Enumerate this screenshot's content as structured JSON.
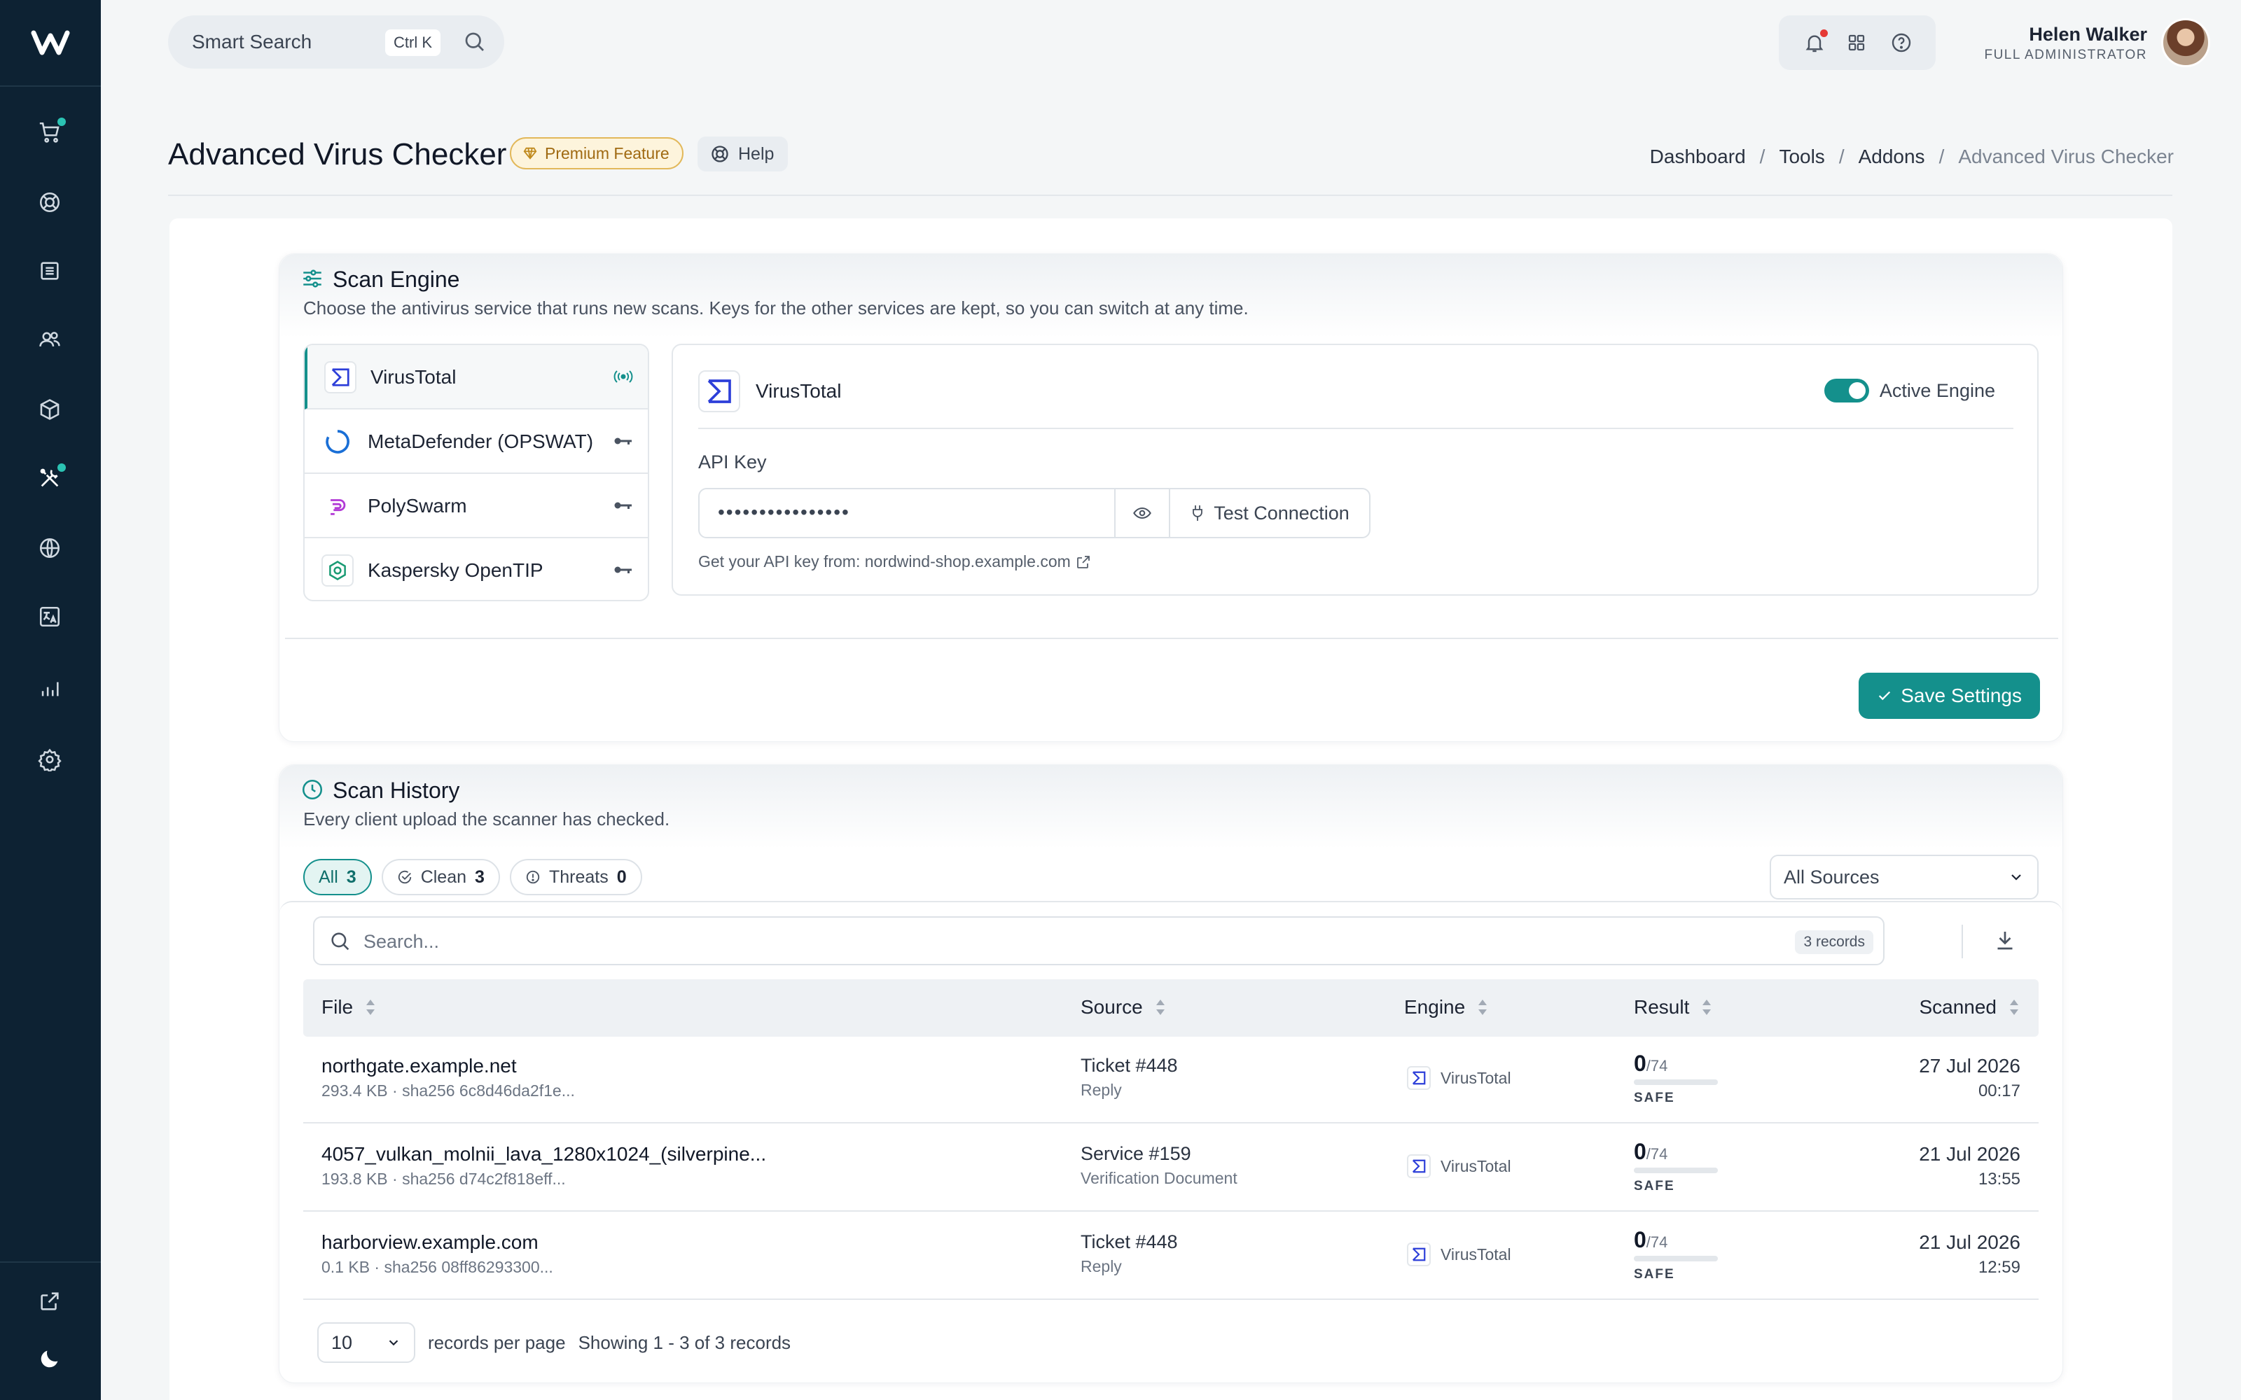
{
  "topbar": {
    "search_label": "Smart Search",
    "search_shortcut": "Ctrl K",
    "user_name": "Helen Walker",
    "user_role": "FULL ADMINISTRATOR"
  },
  "sidebar": {
    "items": [
      {
        "icon": "cart-icon",
        "badge": true
      },
      {
        "icon": "lifebuoy-icon",
        "badge": false
      },
      {
        "icon": "document-icon",
        "badge": false
      },
      {
        "icon": "users-icon",
        "badge": false
      },
      {
        "icon": "box-icon",
        "badge": false
      },
      {
        "icon": "tools-icon",
        "badge": true
      },
      {
        "icon": "globe-icon",
        "badge": false
      },
      {
        "icon": "translate-icon",
        "badge": false
      },
      {
        "icon": "chart-icon",
        "badge": false
      },
      {
        "icon": "settings-icon",
        "badge": false
      }
    ],
    "bottom": [
      "external-link-icon",
      "moon-icon"
    ]
  },
  "header": {
    "title": "Advanced Virus Checker",
    "premium_badge": "Premium Feature",
    "help_label": "Help",
    "breadcrumb": [
      "Dashboard",
      "Tools",
      "Addons",
      "Advanced Virus Checker"
    ]
  },
  "scan_engine": {
    "title": "Scan Engine",
    "subtitle": "Choose the antivirus service that runs new scans. Keys for the other services are kept, so you can switch at any time.",
    "engines": [
      {
        "name": "VirusTotal",
        "active": true
      },
      {
        "name": "MetaDefender (OPSWAT)",
        "active": false
      },
      {
        "name": "PolySwarm",
        "active": false
      },
      {
        "name": "Kaspersky OpenTIP",
        "active": false
      }
    ],
    "selected_engine": "VirusTotal",
    "toggle_label": "Active Engine",
    "toggle_on": true,
    "api_key_label": "API Key",
    "api_key_value": "••••••••••••••••",
    "test_button": "Test Connection",
    "api_hint": "Get your API key from: nordwind-shop.example.com",
    "save_button": "Save Settings"
  },
  "scan_history": {
    "title": "Scan History",
    "subtitle": "Every client upload the scanner has checked.",
    "filters": [
      {
        "label": "All",
        "count": "3",
        "active": true
      },
      {
        "label": "Clean",
        "count": "3",
        "active": false
      },
      {
        "label": "Threats",
        "count": "0",
        "active": false
      }
    ],
    "source_select": "All Sources",
    "search_placeholder": "Search...",
    "record_count": "3 records",
    "columns": [
      "File",
      "Source",
      "Engine",
      "Result",
      "Scanned"
    ],
    "rows": [
      {
        "file": "northgate.example.net",
        "meta": "293.4 KB · sha256 6c8d46da2f1e...",
        "source": "Ticket #448",
        "source_sub": "Reply",
        "engine": "VirusTotal",
        "detections": "0",
        "total": "/74",
        "result": "SAFE",
        "date": "27 Jul 2026",
        "time": "00:17"
      },
      {
        "file": "4057_vulkan_molnii_lava_1280x1024_(silverpine...",
        "meta": "193.8 KB · sha256 d74c2f818eff...",
        "source": "Service #159",
        "source_sub": "Verification Document",
        "engine": "VirusTotal",
        "detections": "0",
        "total": "/74",
        "result": "SAFE",
        "date": "21 Jul 2026",
        "time": "13:55"
      },
      {
        "file": "harborview.example.com",
        "meta": "0.1 KB · sha256 08ff86293300...",
        "source": "Ticket #448",
        "source_sub": "Reply",
        "engine": "VirusTotal",
        "detections": "0",
        "total": "/74",
        "result": "SAFE",
        "date": "21 Jul 2026",
        "time": "12:59"
      }
    ],
    "per_page": "10",
    "per_page_label": "records per page",
    "showing": "Showing 1 - 3 of 3 records"
  },
  "colors": {
    "accent": "#14908c",
    "sidebar": "#0d2233",
    "premium": "#e2b85a"
  }
}
